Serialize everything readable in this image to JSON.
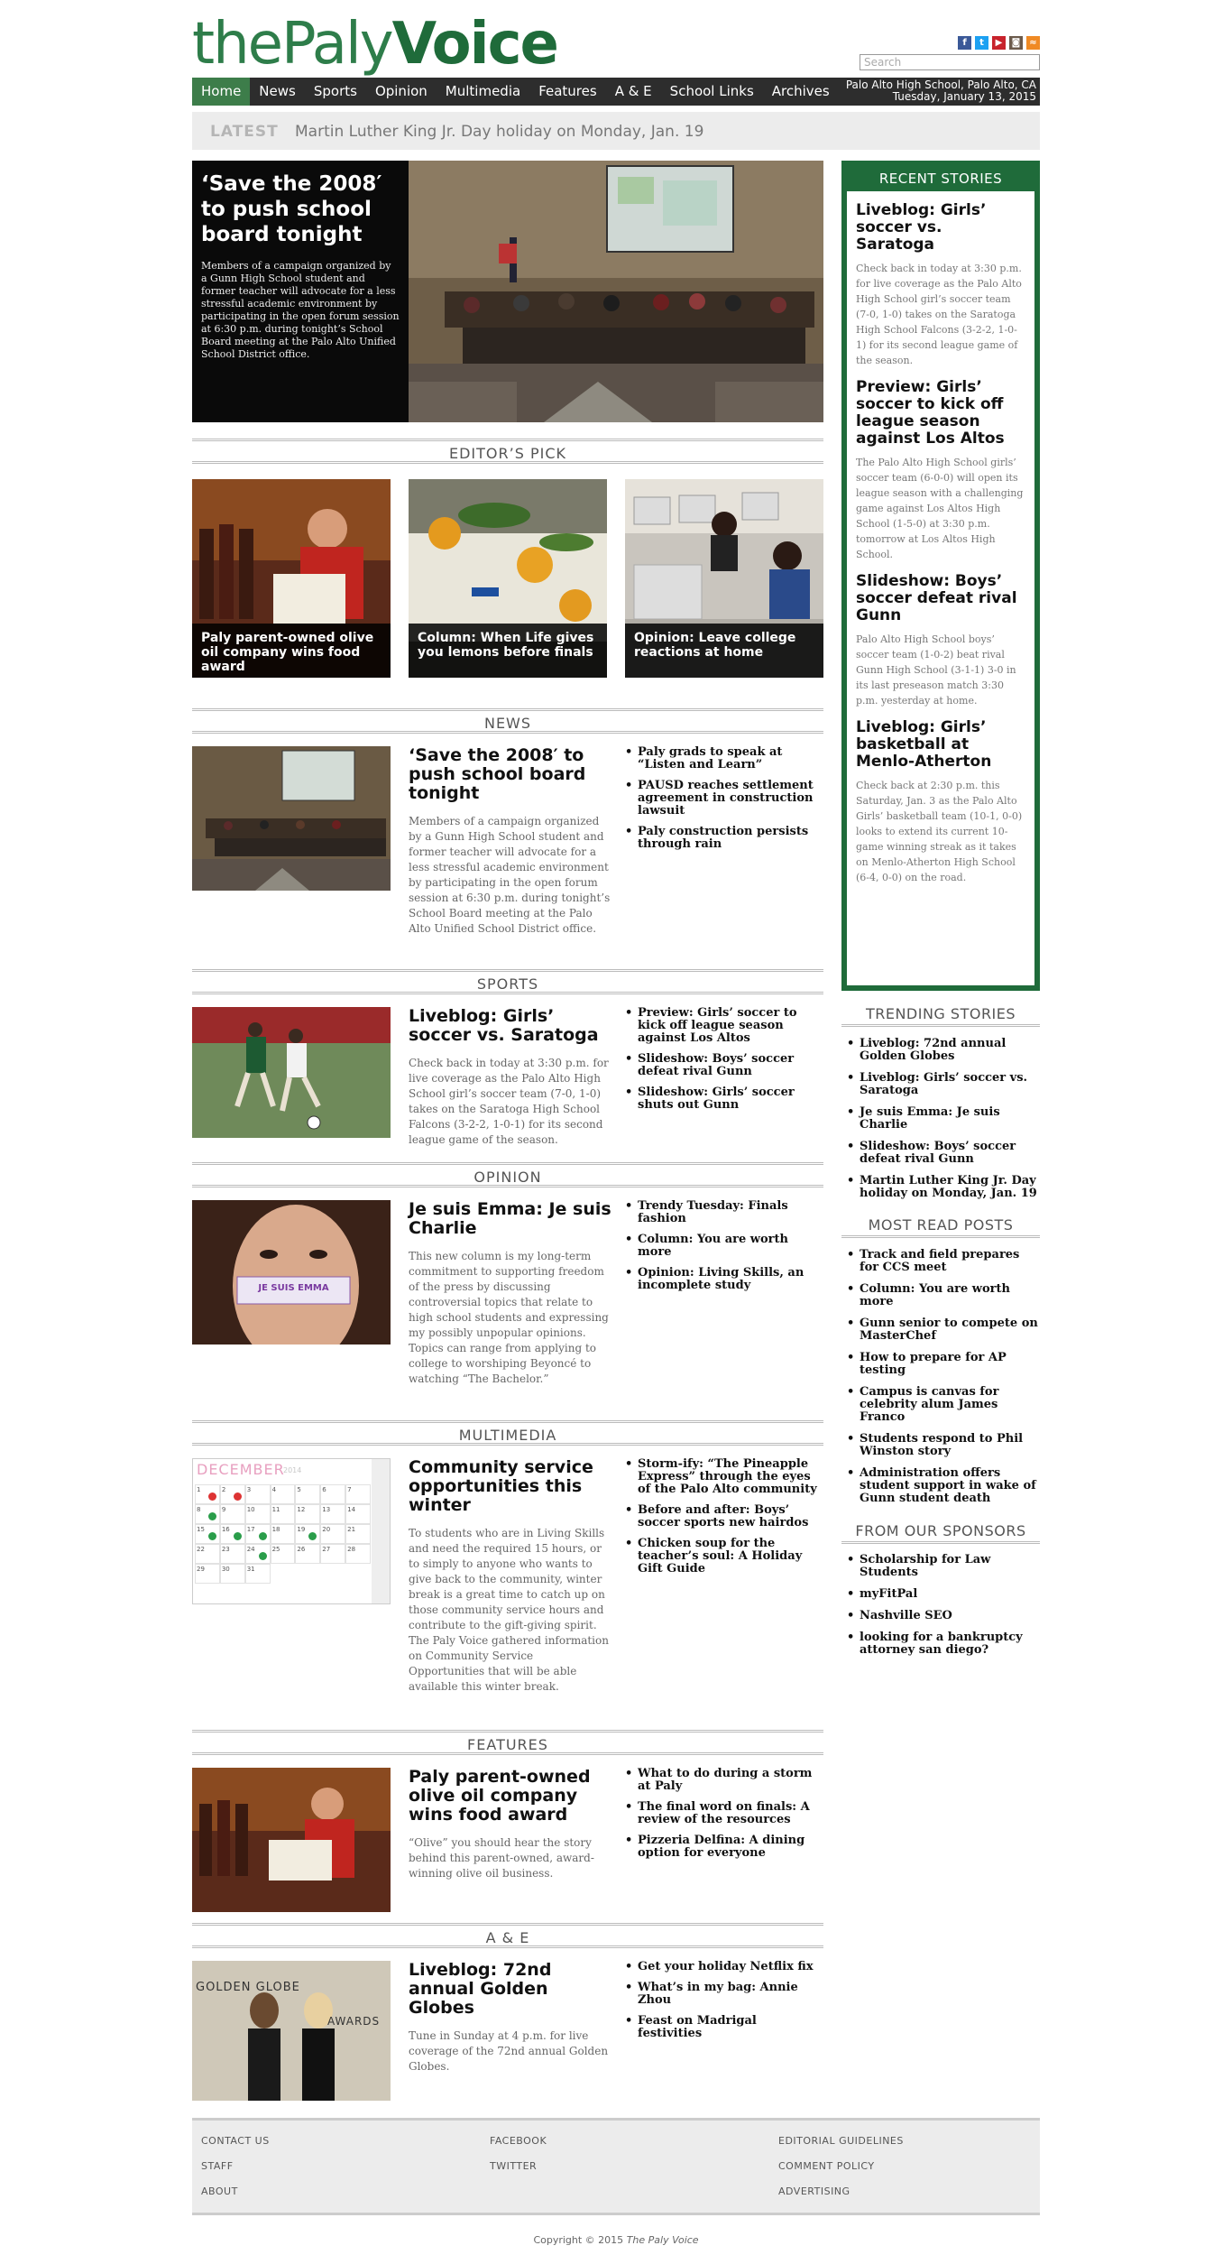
{
  "logo": {
    "part1": "the",
    "part2": "Paly",
    "part3": "Voice"
  },
  "search": {
    "placeholder": "Search"
  },
  "nav": {
    "items": [
      "Home",
      "News",
      "Sports",
      "Opinion",
      "Multimedia",
      "Features",
      "A & E",
      "School Links",
      "Archives"
    ],
    "location": "Palo Alto High School, Palo Alto, CA",
    "date": "Tuesday, January 13, 2015"
  },
  "latest": {
    "tag": "LATEST",
    "text": "Martin Luther King Jr. Day holiday on Monday, Jan. 19"
  },
  "hero": {
    "title": "‘Save the 2008′ to push school board tonight",
    "summary": "Members of a campaign organized by a Gunn High School student and former teacher will advocate for a less stressful academic environment by participating in the open forum session at 6:30 p.m. during tonight’s School Board meeting at the Palo Alto Unified School District office."
  },
  "editors_pick": {
    "heading": "EDITOR’S PICK",
    "items": [
      {
        "caption": "Paly parent-owned olive oil company wins food award"
      },
      {
        "caption": "Column: When Life gives you lemons before finals"
      },
      {
        "caption": "Opinion: Leave college reactions at home"
      }
    ]
  },
  "news": {
    "heading": "NEWS",
    "title": "‘Save the 2008′ to push school board tonight",
    "summary": "Members of a campaign organized by a Gunn High School student and former teacher will advocate for a less stressful academic environment by participating in the open forum session at 6:30 p.m. during tonight’s School Board meeting at the Palo Alto Unified School District office.",
    "links": [
      "Paly grads to speak at “Listen and Learn”",
      "PAUSD reaches settlement agreement in construction lawsuit",
      "Paly construction persists through rain"
    ]
  },
  "sports": {
    "heading": "SPORTS",
    "title": "Liveblog: Girls’ soccer vs. Saratoga",
    "summary": "Check back in today at 3:30 p.m. for live coverage as the Palo Alto High School girl’s soccer team (7-0, 1-0) takes on the Saratoga High School Falcons (3-2-2, 1-0-1) for its second league game of the season.",
    "links": [
      "Preview: Girls’ soccer to kick off league season against Los Altos",
      "Slideshow: Boys’ soccer defeat rival Gunn",
      "Slideshow: Girls’ soccer shuts out Gunn"
    ]
  },
  "opinion": {
    "heading": "OPINION",
    "title": "Je suis Emma: Je suis Charlie",
    "summary": "This new column is my long-term commitment to supporting freedom of the press by discussing controversial topics that relate to high school students and expressing my possibly unpopular opinions. Topics can range from applying to college to worshiping Beyoncé to watching “The Bachelor.”",
    "links": [
      "Trendy Tuesday: Finals fashion",
      "Column: You are worth more",
      "Opinion: Living Skills, an incomplete study"
    ],
    "thumb_text": "JE SUIS EMMA"
  },
  "multimedia": {
    "heading": "MULTIMEDIA",
    "title": "Community service opportunities this winter",
    "summary": "To students who are in Living Skills and need the required 15 hours, or to simply to anyone who wants to give back to the community, winter break is a great time to catch up on those community service hours and contribute to the gift-giving spirit. The Paly Voice gathered information on Community Service Opportunities that will be able available this winter break.",
    "links": [
      "Storm-ify: “The Pineapple Express” through the eyes of the Palo Alto community",
      "Before and after: Boys’ soccer sports new hairdos",
      "Chicken soup for the teacher’s soul: A Holiday Gift Guide"
    ],
    "calendar_month": "DECEMBER",
    "calendar_year": "2014",
    "calendar_days": [
      "1",
      "2",
      "3",
      "4",
      "5",
      "6",
      "7",
      "8",
      "9",
      "10",
      "11",
      "12",
      "13",
      "14",
      "15",
      "16",
      "17",
      "18",
      "19",
      "20",
      "21",
      "22",
      "23",
      "24",
      "25",
      "26",
      "27",
      "28",
      "29",
      "30",
      "31"
    ]
  },
  "features": {
    "heading": "FEATURES",
    "title": "Paly parent-owned olive oil company wins food award",
    "summary": "“Olive” you should hear the story behind this parent-owned, award-winning olive oil business.",
    "links": [
      "What to do during a storm at Paly",
      "The final word on finals: A review of the resources",
      "Pizzeria Delfina: A dining option for everyone"
    ]
  },
  "ae": {
    "heading": "A & E",
    "title": "Liveblog: 72nd annual Golden Globes",
    "summary": "Tune in Sunday at 4 p.m. for live coverage of the 72nd annual Golden Globes.",
    "links": [
      "Get your holiday Netflix fix",
      "What’s in my bag: Annie Zhou",
      "Feast on Madrigal festivities"
    ],
    "thumb_text_a": "GOLDEN GLOBE",
    "thumb_text_b": "AWARDS"
  },
  "recent": {
    "heading": "RECENT STORIES",
    "items": [
      {
        "title": "Liveblog: Girls’ soccer vs. Saratoga",
        "summary": "Check back in today at 3:30 p.m. for live coverage as the Palo Alto High School girl’s soccer team (7-0, 1-0) takes on the Saratoga High School Falcons (3-2-2, 1-0-1) for its second league game of the season."
      },
      {
        "title": "Preview: Girls’ soccer to kick off league season against Los Altos",
        "summary": "The Palo Alto High School girls’ soccer team (6-0-0) will open its league season with a challenging game against Los Altos High School (1-5-0) at 3:30 p.m. tomorrow at Los Altos High School."
      },
      {
        "title": "Slideshow: Boys’ soccer defeat rival Gunn",
        "summary": "Palo Alto High School boys’ soccer team (1-0-2) beat rival Gunn High School (3-1-1) 3-0 in its last preseason match 3:30 p.m. yesterday at home."
      },
      {
        "title": "Liveblog: Girls’ basketball at Menlo-Atherton",
        "summary": "Check back at 2:30 p.m. this Saturday, Jan. 3 as the Palo Alto Girls’ basketball team (10-1, 0-0) looks to extend its current 10-game winning streak as it takes on Menlo-Atherton High School (6-4, 0-0) on the road."
      }
    ]
  },
  "trending": {
    "heading": "TRENDING STORIES",
    "items": [
      "Liveblog: 72nd annual Golden Globes",
      "Liveblog: Girls’ soccer vs. Saratoga",
      "Je suis Emma: Je suis Charlie",
      "Slideshow: Boys’ soccer defeat rival Gunn",
      "Martin Luther King Jr. Day holiday on Monday, Jan. 19"
    ]
  },
  "most_read": {
    "heading": "MOST READ POSTS",
    "items": [
      "Track and field prepares for CCS meet",
      "Column: You are worth more",
      "Gunn senior to compete on MasterChef",
      "How to prepare for AP testing",
      "Campus is canvas for celebrity alum James Franco",
      "Students respond to Phil Winston story",
      "Administration offers student support in wake of Gunn student death"
    ]
  },
  "sponsors": {
    "heading": "FROM OUR SPONSORS",
    "items": [
      "Scholarship for Law Students",
      "myFitPal",
      "Nashville SEO",
      "looking for a bankruptcy attorney san diego?"
    ]
  },
  "footer": {
    "col1": [
      "CONTACT US",
      "STAFF",
      "ABOUT"
    ],
    "col2": [
      "FACEBOOK",
      "TWITTER"
    ],
    "col3": [
      "EDITORIAL GUIDELINES",
      "COMMENT POLICY",
      "ADVERTISING"
    ],
    "copyright_prefix": "Copyright © 2015",
    "copyright_name": "The Paly Voice"
  },
  "colors": {
    "brand_green": "#1f6b3a",
    "nav_active": "#3d7d4a",
    "nav_bg": "#2d2d2d"
  }
}
